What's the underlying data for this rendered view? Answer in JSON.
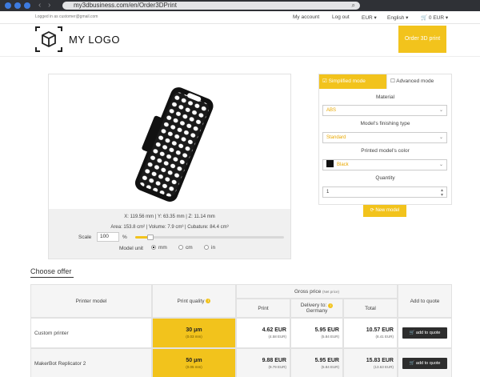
{
  "browser": {
    "url": "my3dbusiness.com/en/Order3DPrint"
  },
  "topnav": {
    "logged_in": "Logged in as customer@gmail.com",
    "my_account": "My account",
    "log_out": "Log out",
    "currency": "EUR ▾",
    "language": "English ▾",
    "cart": "0 EUR ▾"
  },
  "header": {
    "logo_text": "MY  LOGO",
    "order_button": "Order 3D print"
  },
  "viewer": {
    "dims": "X: 119.56 mm  |  Y: 63.35 mm  |  Z: 11.14 mm",
    "measures": "Area: 153.8 cm²  |  Volume: 7.9 cm³  |  Cubature: 84.4 cm³",
    "scale_label": "Scale",
    "scale_value": "100",
    "scale_unit": "%",
    "scale_fraction": 0.1,
    "unit_label": "Model unit",
    "units": [
      "mm",
      "cm",
      "in"
    ],
    "selected_unit": "mm"
  },
  "config": {
    "mode_simple": "Simplified mode",
    "mode_advanced": "Advanced mode",
    "material_label": "Material",
    "material_value": "ABS",
    "finishing_label": "Model's finishing type",
    "finishing_value": "Standard",
    "color_label": "Printed model's color",
    "color_value": "Black",
    "color_hex": "#111111",
    "quantity_label": "Quantity",
    "quantity_value": "1",
    "new_model": "New model"
  },
  "offer": {
    "title": "Choose offer",
    "headers": {
      "printer_model": "Printer model",
      "print_quality": "Print quality",
      "gross_price": "Gross price",
      "net_price_note": "(Net price)",
      "print": "Print",
      "delivery": "Delivery to:",
      "delivery_country": "Germany",
      "total": "Total",
      "add_to_quote": "Add to quote"
    },
    "rows": [
      {
        "printer": "Custom printer",
        "quality": "30 μm",
        "quality_sub": "(0.03 mm)",
        "print": "4.62 EUR",
        "print_net": "(4.58 EUR)",
        "delivery": "5.95  EUR",
        "delivery_net": "(5.84 EUR)",
        "total": "10.57 EUR",
        "total_net": "(8.41 EUR)",
        "button": "add to quote"
      },
      {
        "printer": "MakerBot Replicator 2",
        "quality": "50 μm",
        "quality_sub": "(0.05 mm)",
        "print": "9.88 EUR",
        "print_net": "(9.79 EUR)",
        "delivery": "5.95  EUR",
        "delivery_net": "(5.84 EUR)",
        "total": "15.83 EUR",
        "total_net": "(13.63 EUR)",
        "button": "add to quote"
      }
    ]
  }
}
